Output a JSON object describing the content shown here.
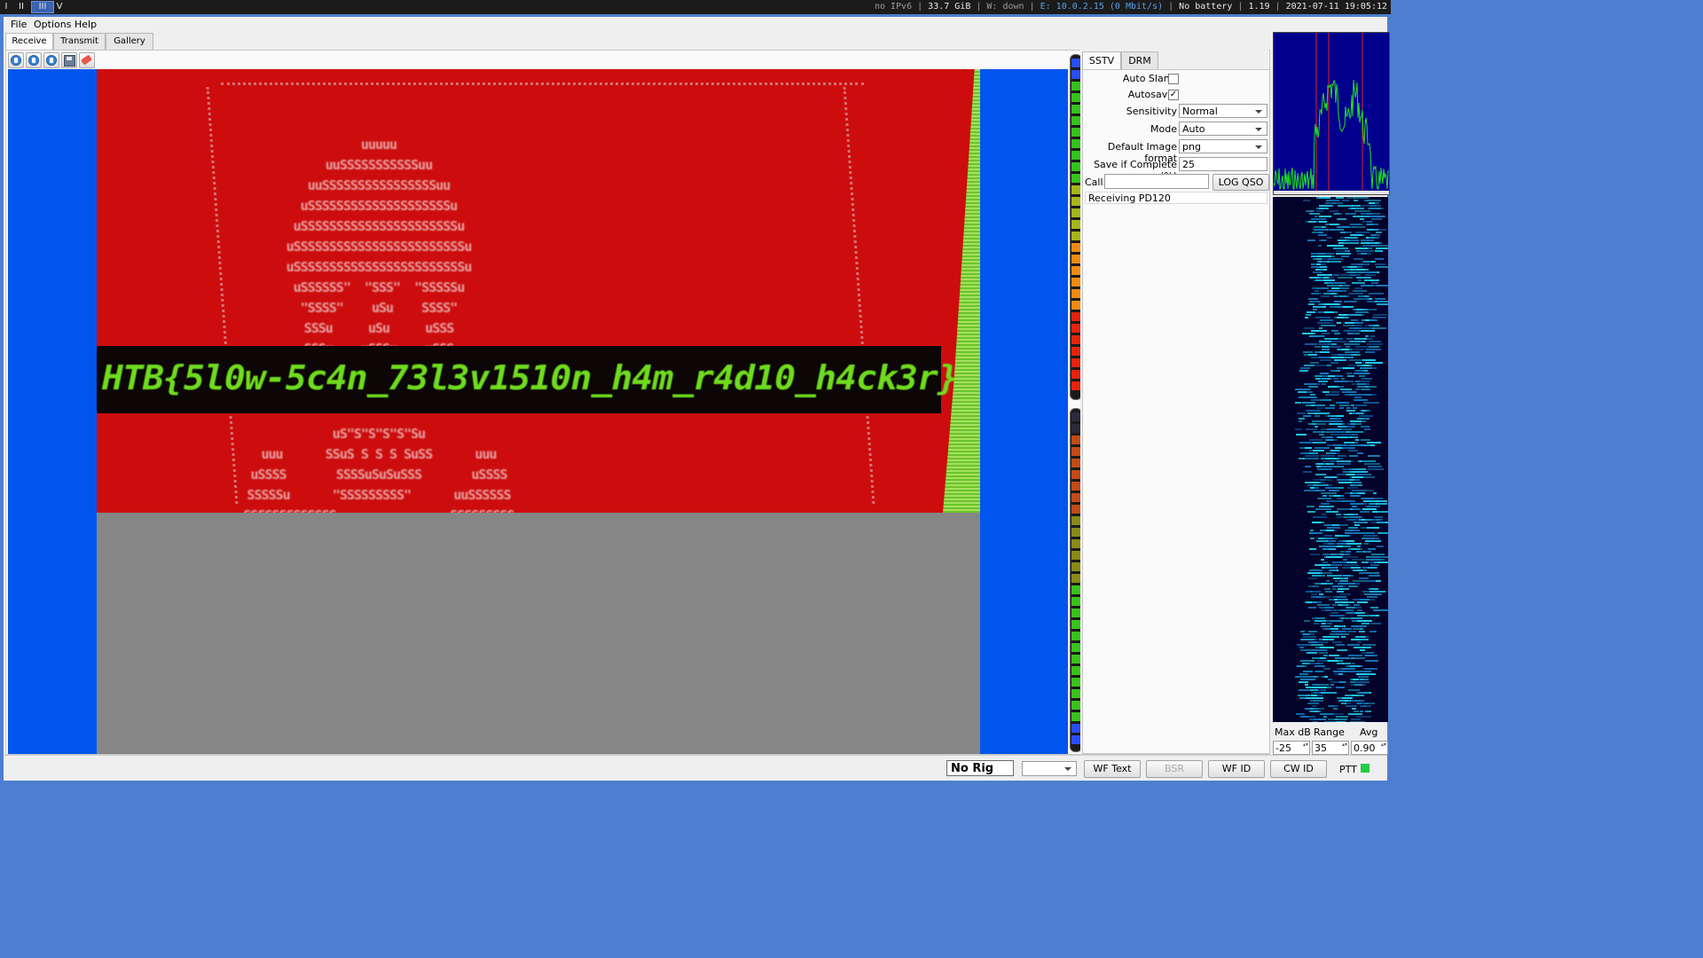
{
  "topbar": {
    "workspaces": [
      "I",
      "II",
      "III",
      "V"
    ],
    "active_workspace": "III",
    "status": {
      "ipv6": "no IPv6",
      "disk": "33.7 GiB",
      "wifi": "W: down",
      "ethernet": "E: 10.0.2.15 (0 Mbit/s)",
      "battery": "No battery",
      "load": "1.19",
      "datetime": "2021-07-11 19:05:12"
    }
  },
  "menu": {
    "file": "File",
    "options": "Options",
    "help": "Help"
  },
  "tabs": {
    "receive": "Receive",
    "transmit": "Transmit",
    "gallery": "Gallery"
  },
  "toolbar_icons": [
    "start-icon",
    "stop-icon",
    "refresh-icon",
    "save-icon",
    "eraser-icon"
  ],
  "image": {
    "flag": "HTB{5l0w-5c4n_73l3v1510n_h4m_r4d10_h4ck3r}",
    "art_lines": [
      "uuuuu",
      "uuSSSSSSSSSSSuu",
      "uuSSSSSSSSSSSSSSSSuu",
      "uSSSSSSSSSSSSSSSSSSSSu",
      "uSSSSSSSSSSSSSSSSSSSSSSu",
      "uSSSSSSSSSSSSSSSSSSSSSSSSu",
      "uSSSSSSSSSSSSSSSSSSSSSSSSu",
      "uSSSSSS\"  \"SSS\"  \"SSSSSu",
      "\"SSSS\"    uSu    SSSS\"",
      "SSSu     uSu     uSSS",
      "SSSu    uSSSu    uSSS"
    ],
    "art_lines_lower": [
      "uS\"S\"S\"S\"S\"Su",
      "uuu      SSuS S S S SuSS      uuu",
      "uSSSS       SSSSuSuSuSSS       uSSSS",
      "SSSSSu      \"SSSSSSSSS\"      uuSSSSSS",
      "SSSSSSSSSSSSS                SSSSSSSSS"
    ]
  },
  "side_tabs": {
    "sstv": "SSTV",
    "drm": "DRM"
  },
  "settings": {
    "auto_slant_label": "Auto Slant",
    "auto_slant": false,
    "autosave_label": "Autosave",
    "autosave": true,
    "autosave_mark": "✓",
    "sensitivity_label": "Sensitivity",
    "sensitivity": "Normal",
    "mode_label": "Mode",
    "mode": "Auto",
    "format_label": "Default Image format",
    "format": "png",
    "save_complete_label": "Save if Complete (%)",
    "save_complete": "25",
    "call_label": "Call:",
    "call_value": "",
    "log_qso": "LOG QSO",
    "status_text": "Receiving PD120"
  },
  "waterfall": {
    "maxdb_label": "Max dB",
    "range_label": "Range",
    "avg_label": "Avg",
    "maxdb": "-25",
    "range": "35",
    "avg": "0.90"
  },
  "bottom": {
    "rig": "No Rig",
    "rig_combo": "",
    "wf_text": "WF Text",
    "bsr": "BSR",
    "wf_id": "WF ID",
    "cw_id": "CW ID",
    "ptt": "PTT"
  },
  "colors": {
    "image_red": "#cd0d0d",
    "image_blue": "#0055ee",
    "flag_green": "#6fdc1e",
    "ptt_indicator": "#22cc44"
  }
}
